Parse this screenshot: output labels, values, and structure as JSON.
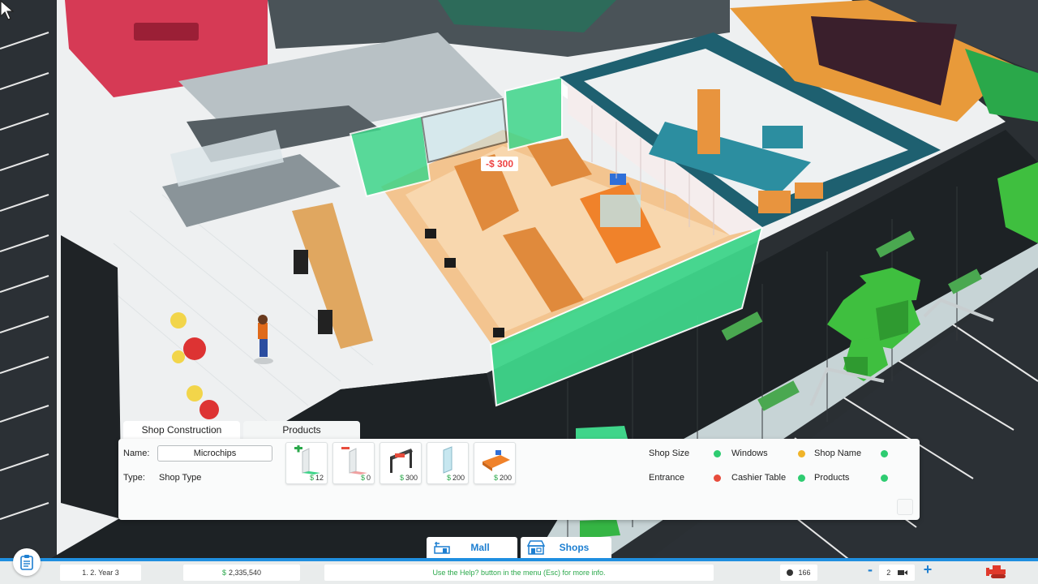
{
  "scene": {
    "cost_popup": "-$ 300"
  },
  "panel": {
    "tabs": [
      {
        "label": "Shop Construction",
        "active": true
      },
      {
        "label": "Products",
        "active": false
      }
    ],
    "name_label": "Name:",
    "name_value": "Microchips",
    "type_label": "Type:",
    "type_value": "Shop Type",
    "currency": "$",
    "tools": [
      {
        "icon": "add-wall-icon",
        "price": "12"
      },
      {
        "icon": "remove-wall-icon",
        "price": "0"
      },
      {
        "icon": "entrance-icon",
        "price": "300"
      },
      {
        "icon": "window-icon",
        "price": "200"
      },
      {
        "icon": "cashier-table-icon",
        "price": "200"
      }
    ],
    "status": [
      {
        "label": "Shop Size",
        "color": "#2ecc71"
      },
      {
        "label": "Windows",
        "color": "#f0b429"
      },
      {
        "label": "Shop Name",
        "color": "#2ecc71"
      },
      {
        "label": "Entrance",
        "color": "#e74c3c"
      },
      {
        "label": "Cashier Table",
        "color": "#2ecc71"
      },
      {
        "label": "Products",
        "color": "#2ecc71"
      }
    ]
  },
  "modes": {
    "mall": "Mall",
    "shops": "Shops"
  },
  "bottombar": {
    "date": "1. 2.  Year 3",
    "currency": "$",
    "money": "2,335,540",
    "help": "Use the Help? button in the menu (Esc) for more info.",
    "visitors": "166",
    "speed_minus": "-",
    "speed": "2",
    "speed_plus": "+"
  },
  "colors": {
    "accent": "#1f8fe0",
    "money_green": "#2aa84a",
    "shop_wall_green": "#3fd58a"
  }
}
